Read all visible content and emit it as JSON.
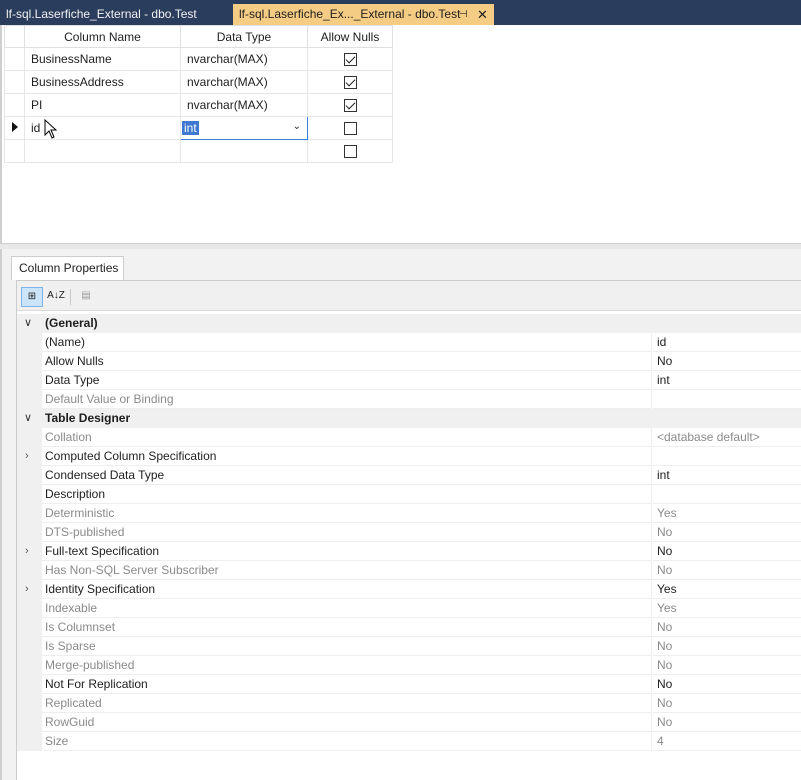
{
  "tabs": [
    {
      "label": "lf-sql.Laserfiche_External - dbo.Test"
    },
    {
      "label": "lf-sql.Laserfiche_Ex..._External - dbo.Test",
      "pin": "⊣",
      "close": "✕"
    }
  ],
  "grid": {
    "headers": {
      "column_name": "Column Name",
      "data_type": "Data Type",
      "allow_nulls": "Allow Nulls"
    },
    "rows": [
      {
        "name": "BusinessName",
        "type": "nvarchar(MAX)",
        "nulls": true
      },
      {
        "name": "BusinessAddress",
        "type": "nvarchar(MAX)",
        "nulls": true
      },
      {
        "name": "PI",
        "type": "nvarchar(MAX)",
        "nulls": true
      },
      {
        "name": "id",
        "type": "int",
        "nulls": false
      }
    ]
  },
  "properties": {
    "tab_label": "Column Properties",
    "toolbar": {
      "categorized": "⊞",
      "alphabetical": "A↓Z",
      "pages": "▤"
    },
    "sections": [
      {
        "title": "(General)",
        "rows": [
          {
            "name": "(Name)",
            "value": "id"
          },
          {
            "name": "Allow Nulls",
            "value": "No"
          },
          {
            "name": "Data Type",
            "value": "int"
          },
          {
            "name": "Default Value or Binding",
            "value": ""
          }
        ]
      },
      {
        "title": "Table Designer",
        "rows": [
          {
            "name": "Collation",
            "value": "<database default>"
          },
          {
            "name": "Computed Column Specification",
            "value": ""
          },
          {
            "name": "Condensed Data Type",
            "value": "int"
          },
          {
            "name": "Description",
            "value": ""
          },
          {
            "name": "Deterministic",
            "value": "Yes"
          },
          {
            "name": "DTS-published",
            "value": "No"
          },
          {
            "name": "Full-text Specification",
            "value": "No"
          },
          {
            "name": "Has Non-SQL Server Subscriber",
            "value": "No"
          },
          {
            "name": "Identity Specification",
            "value": "Yes"
          },
          {
            "name": "Indexable",
            "value": "Yes"
          },
          {
            "name": "Is Columnset",
            "value": "No"
          },
          {
            "name": "Is Sparse",
            "value": "No"
          },
          {
            "name": "Merge-published",
            "value": "No"
          },
          {
            "name": "Not For Replication",
            "value": "No"
          },
          {
            "name": "Replicated",
            "value": "No"
          },
          {
            "name": "RowGuid",
            "value": "No"
          },
          {
            "name": "Size",
            "value": "4"
          }
        ]
      }
    ]
  }
}
